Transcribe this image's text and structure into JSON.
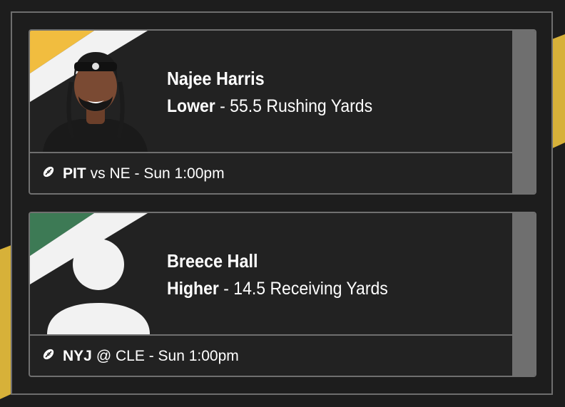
{
  "colors": {
    "background": "#1d1d1d",
    "accent_yellow": "#e2b93b",
    "card_bg": "#222222",
    "border": "#707070"
  },
  "cards": [
    {
      "player": "Najee Harris",
      "direction": "Lower",
      "separator": " - ",
      "line": "55.5 Rushing Yards",
      "team": "PIT",
      "matchup": "vs NE - Sun 1:00pm",
      "stripe_color": "#f1bd3f",
      "headshot": "player-photo",
      "icon": "football-icon"
    },
    {
      "player": "Breece Hall",
      "direction": "Higher",
      "separator": " - ",
      "line": "14.5 Receiving Yards",
      "team": "NYJ",
      "matchup": "@ CLE - Sun 1:00pm",
      "stripe_color": "#3d7a55",
      "headshot": "placeholder-silhouette",
      "icon": "football-icon"
    }
  ]
}
